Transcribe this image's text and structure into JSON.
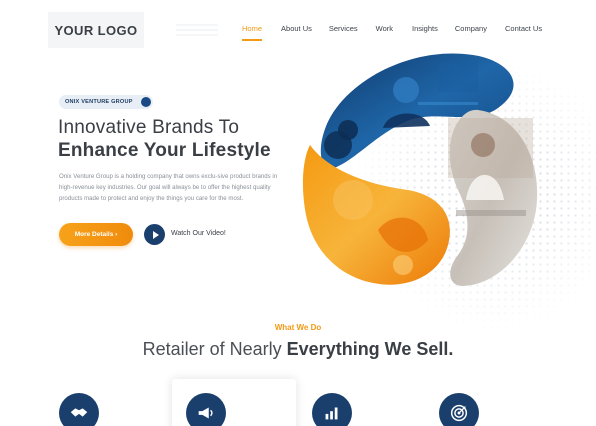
{
  "header": {
    "logo_text": "YOUR LOGO",
    "nav": [
      {
        "label": "Home",
        "active": true
      },
      {
        "label": "About Us",
        "active": false
      },
      {
        "label": "Services",
        "active": false
      },
      {
        "label": "Work",
        "active": false
      },
      {
        "label": "Insights",
        "active": false
      },
      {
        "label": "Company",
        "active": false
      },
      {
        "label": "Contact Us",
        "active": false
      }
    ]
  },
  "hero": {
    "badge": "ONIX VENTURE GROUP",
    "title_line1": "Innovative Brands To",
    "title_line2": "Enhance Your Lifestyle",
    "description": "Onix Venture Group is a holding company that owns exclu-sive product brands in high-revenue key industries. Our goal will always be to offer the highest quality products made to protect and enjoy the things you care for the most.",
    "more_button": "More Details ›",
    "video_label": "Watch Our Video!"
  },
  "what_we_do": {
    "subtitle": "What We Do",
    "title_light": "Retailer of Nearly ",
    "title_bold": "Everything We Sell."
  },
  "services": [
    {
      "icon": "handshake-icon"
    },
    {
      "icon": "megaphone-icon"
    },
    {
      "icon": "bar-chart-icon"
    },
    {
      "icon": "target-icon"
    }
  ],
  "colors": {
    "accent": "#f29a14",
    "navy": "#1b3f6d",
    "text_dark": "#3a3f45",
    "text_muted": "#8a9098"
  }
}
